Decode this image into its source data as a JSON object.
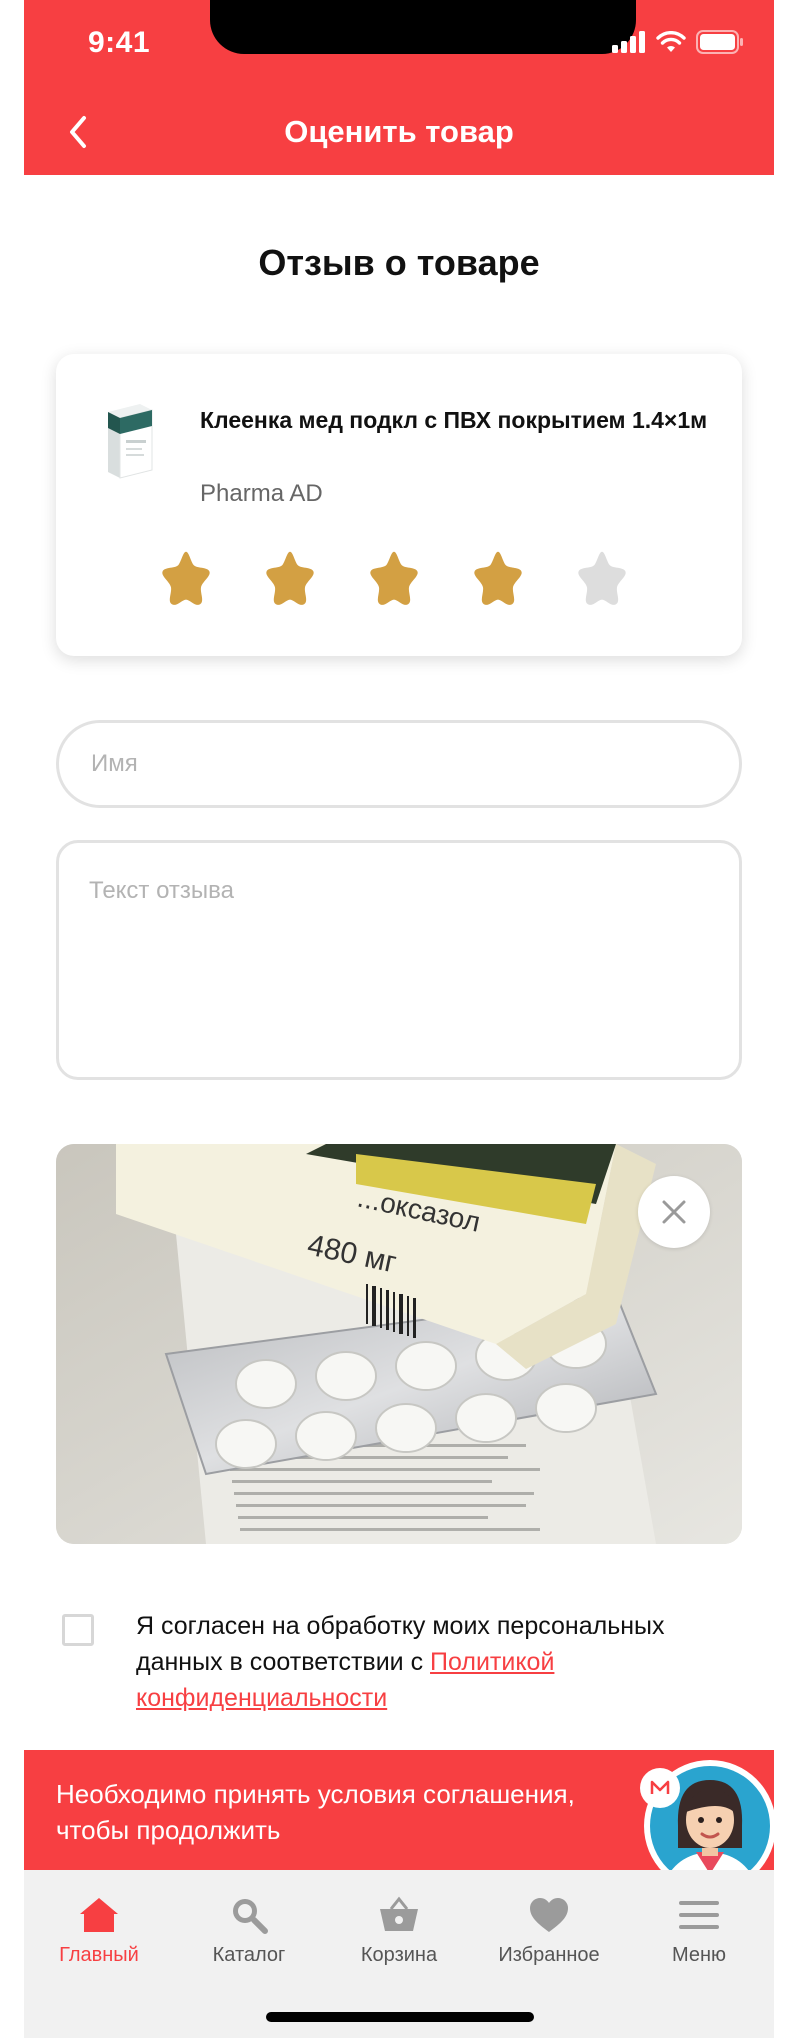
{
  "status_bar": {
    "time": "9:41"
  },
  "header": {
    "title": "Оценить товар"
  },
  "section": {
    "title": "Отзыв о товаре"
  },
  "product": {
    "name": "Клеенка мед подкл с ПВХ покрытием 1.4×1м",
    "brand": "Pharma AD",
    "rating": 4,
    "max_rating": 5
  },
  "form": {
    "name_placeholder": "Имя",
    "name_value": "",
    "review_placeholder": "Текст отзыва",
    "review_value": ""
  },
  "photo": {
    "package_text_1": "...оксазол",
    "package_text_2": "480 мг"
  },
  "consent": {
    "text_before": "Я согласен на обработку моих персональных данных в соответствии с ",
    "link_text": "Политикой конфиденциальности",
    "checked": false
  },
  "warning": {
    "text": "Необходимо принять условия соглашения, чтобы продолжить"
  },
  "tabbar": {
    "items": [
      {
        "label": "Главный",
        "icon": "home-icon",
        "active": true
      },
      {
        "label": "Каталог",
        "icon": "search-icon",
        "active": false
      },
      {
        "label": "Корзина",
        "icon": "basket-icon",
        "active": false
      },
      {
        "label": "Избранное",
        "icon": "heart-icon",
        "active": false
      },
      {
        "label": "Меню",
        "icon": "menu-icon",
        "active": false
      }
    ]
  },
  "colors": {
    "accent": "#f73f42",
    "star_filled": "#d3a043",
    "star_empty": "#dddddd",
    "tabbar_bg": "#f1f1f1"
  }
}
